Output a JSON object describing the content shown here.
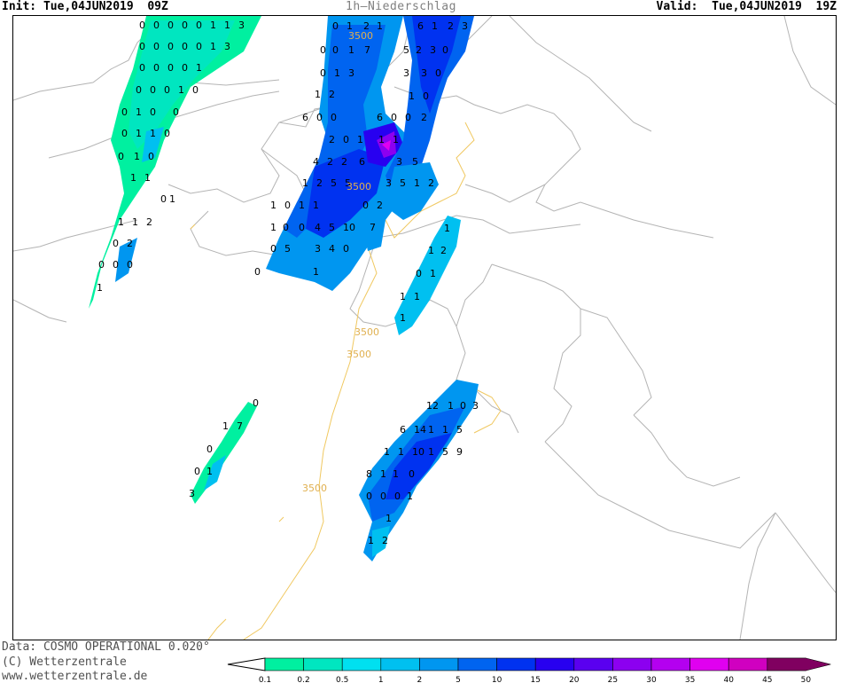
{
  "header": {
    "init": "Init: Tue,04JUN2019  09Z",
    "title": "1h—Niederschlag",
    "valid": "Valid:  Tue,04JUN2019  19Z"
  },
  "footer": {
    "data_line": "Data: COSMO OPERATIONAL 0.020°",
    "copyright": "(C) Wetterzentrale",
    "url": "www.wetterzentrale.de"
  },
  "contour_label": "3500",
  "legend": {
    "ticks": [
      "0.1",
      "0.2",
      "0.5",
      "1",
      "2",
      "5",
      "10",
      "15",
      "20",
      "25",
      "30",
      "35",
      "40",
      "45",
      "50"
    ],
    "colors": [
      "#00f0a0",
      "#00e6c0",
      "#00e0f0",
      "#00c0f0",
      "#0096f0",
      "#0064f0",
      "#0032f0",
      "#2800f0",
      "#5a00f0",
      "#8c00f0",
      "#b400f0",
      "#e000f0",
      "#d000c0",
      "#b00090",
      "#800060"
    ]
  },
  "values": [
    "0",
    "0",
    "0",
    "0",
    "0",
    "1",
    "1",
    "3",
    "0",
    "0",
    "0",
    "0",
    "0",
    "1",
    "3",
    "0",
    "0",
    "0",
    "0",
    "1",
    "0",
    "0",
    "0",
    "1",
    "0",
    "0",
    "1",
    "0",
    "0",
    "0",
    "1",
    "1",
    "0",
    "0",
    "1",
    "0",
    "1",
    "1",
    "0",
    "1",
    "1",
    "1",
    "2",
    "0",
    "2",
    "0",
    "0",
    "0",
    "1",
    "0",
    "1",
    "2",
    "1",
    "0",
    "0",
    "1",
    "7",
    "0",
    "1",
    "3",
    "1",
    "2",
    "6",
    "1",
    "2",
    "3",
    "5",
    "2",
    "3",
    "0",
    "3",
    "3",
    "0",
    "1",
    "0",
    "6",
    "0",
    "0",
    "6",
    "0",
    "0",
    "2",
    "2",
    "0",
    "1",
    "1",
    "1",
    "4",
    "2",
    "2",
    "6",
    "3",
    "5",
    "1",
    "2",
    "5",
    "5",
    "3",
    "5",
    "1",
    "2",
    "1",
    "0",
    "1",
    "1",
    "0",
    "2",
    "1",
    "0",
    "0",
    "4",
    "5",
    "10",
    "7",
    "0",
    "5",
    "3",
    "4",
    "0",
    "1",
    "0",
    "1",
    "1",
    "2",
    "0",
    "1",
    "1",
    "1",
    "1",
    "0",
    "1",
    "7",
    "0",
    "0",
    "1",
    "3",
    "12",
    "1",
    "0",
    "3",
    "6",
    "14",
    "1",
    "1",
    "5",
    "1",
    "1",
    "10",
    "1",
    "5",
    "9",
    "8",
    "1",
    "1",
    "0",
    "0",
    "0",
    "0",
    "1",
    "1",
    "2",
    "1"
  ]
}
